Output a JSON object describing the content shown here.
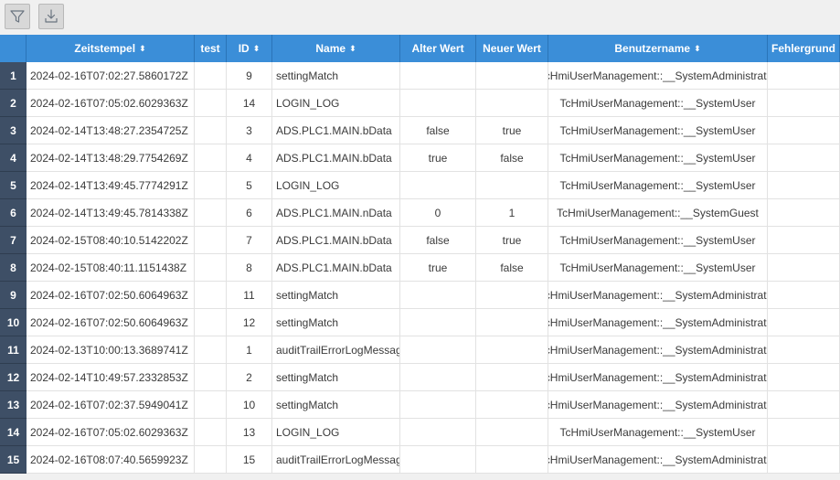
{
  "toolbar": {
    "filter_icon": "filter-icon",
    "export_icon": "download-icon"
  },
  "columns": [
    {
      "key": "timestamp",
      "label": "Zeitstempel",
      "sortable": true
    },
    {
      "key": "test",
      "label": "test",
      "sortable": false
    },
    {
      "key": "id",
      "label": "ID",
      "sortable": true
    },
    {
      "key": "name",
      "label": "Name",
      "sortable": true
    },
    {
      "key": "old",
      "label": "Alter Wert",
      "sortable": false
    },
    {
      "key": "new",
      "label": "Neuer Wert",
      "sortable": false
    },
    {
      "key": "user",
      "label": "Benutzername",
      "sortable": true
    },
    {
      "key": "error",
      "label": "Fehlergrund",
      "sortable": false
    }
  ],
  "sort_glyph": "⬍",
  "rows": [
    {
      "num": "1",
      "timestamp": "2024-02-16T07:02:27.5860172Z",
      "test": "",
      "id": "9",
      "name": "settingMatch",
      "old": "",
      "new": "",
      "user": "TcHmiUserManagement::__SystemAdministrator",
      "error": ""
    },
    {
      "num": "2",
      "timestamp": "2024-02-16T07:05:02.6029363Z",
      "test": "",
      "id": "14",
      "name": "LOGIN_LOG",
      "old": "",
      "new": "",
      "user": "TcHmiUserManagement::__SystemUser",
      "error": ""
    },
    {
      "num": "3",
      "timestamp": "2024-02-14T13:48:27.2354725Z",
      "test": "",
      "id": "3",
      "name": "ADS.PLC1.MAIN.bData",
      "old": "false",
      "new": "true",
      "user": "TcHmiUserManagement::__SystemUser",
      "error": ""
    },
    {
      "num": "4",
      "timestamp": "2024-02-14T13:48:29.7754269Z",
      "test": "",
      "id": "4",
      "name": "ADS.PLC1.MAIN.bData",
      "old": "true",
      "new": "false",
      "user": "TcHmiUserManagement::__SystemUser",
      "error": ""
    },
    {
      "num": "5",
      "timestamp": "2024-02-14T13:49:45.7774291Z",
      "test": "",
      "id": "5",
      "name": "LOGIN_LOG",
      "old": "",
      "new": "",
      "user": "TcHmiUserManagement::__SystemUser",
      "error": ""
    },
    {
      "num": "6",
      "timestamp": "2024-02-14T13:49:45.7814338Z",
      "test": "",
      "id": "6",
      "name": "ADS.PLC1.MAIN.nData",
      "old": "0",
      "new": "1",
      "user": "TcHmiUserManagement::__SystemGuest",
      "error": ""
    },
    {
      "num": "7",
      "timestamp": "2024-02-15T08:40:10.5142202Z",
      "test": "",
      "id": "7",
      "name": "ADS.PLC1.MAIN.bData",
      "old": "false",
      "new": "true",
      "user": "TcHmiUserManagement::__SystemUser",
      "error": ""
    },
    {
      "num": "8",
      "timestamp": "2024-02-15T08:40:11.1151438Z",
      "test": "",
      "id": "8",
      "name": "ADS.PLC1.MAIN.bData",
      "old": "true",
      "new": "false",
      "user": "TcHmiUserManagement::__SystemUser",
      "error": ""
    },
    {
      "num": "9",
      "timestamp": "2024-02-16T07:02:50.6064963Z",
      "test": "",
      "id": "11",
      "name": "settingMatch",
      "old": "",
      "new": "",
      "user": "TcHmiUserManagement::__SystemAdministrator",
      "error": ""
    },
    {
      "num": "10",
      "timestamp": "2024-02-16T07:02:50.6064963Z",
      "test": "",
      "id": "12",
      "name": "settingMatch",
      "old": "",
      "new": "",
      "user": "TcHmiUserManagement::__SystemAdministrator",
      "error": ""
    },
    {
      "num": "11",
      "timestamp": "2024-02-13T10:00:13.3689741Z",
      "test": "",
      "id": "1",
      "name": "auditTrailErrorLogMessage",
      "old": "",
      "new": "",
      "user": "TcHmiUserManagement::__SystemAdministrator",
      "error": ""
    },
    {
      "num": "12",
      "timestamp": "2024-02-14T10:49:57.2332853Z",
      "test": "",
      "id": "2",
      "name": "settingMatch",
      "old": "",
      "new": "",
      "user": "TcHmiUserManagement::__SystemAdministrator",
      "error": ""
    },
    {
      "num": "13",
      "timestamp": "2024-02-16T07:02:37.5949041Z",
      "test": "",
      "id": "10",
      "name": "settingMatch",
      "old": "",
      "new": "",
      "user": "TcHmiUserManagement::__SystemAdministrator",
      "error": ""
    },
    {
      "num": "14",
      "timestamp": "2024-02-16T07:05:02.6029363Z",
      "test": "",
      "id": "13",
      "name": "LOGIN_LOG",
      "old": "",
      "new": "",
      "user": "TcHmiUserManagement::__SystemUser",
      "error": ""
    },
    {
      "num": "15",
      "timestamp": "2024-02-16T08:07:40.5659923Z",
      "test": "",
      "id": "15",
      "name": "auditTrailErrorLogMessage",
      "old": "",
      "new": "",
      "user": "TcHmiUserManagement::__SystemAdministrator",
      "error": ""
    }
  ]
}
